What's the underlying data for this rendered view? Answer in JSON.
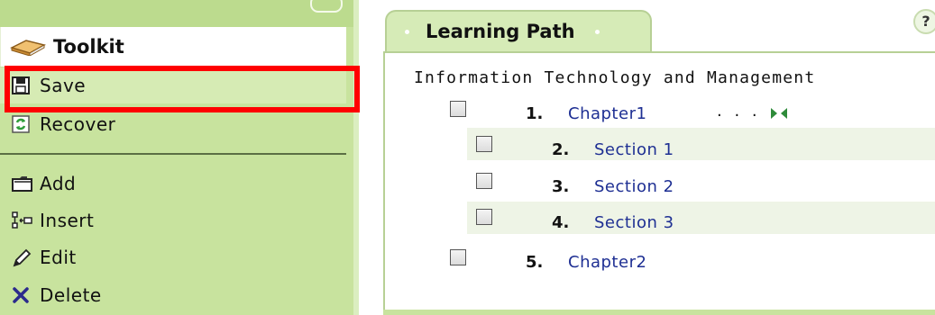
{
  "toolkit": {
    "title": "Toolkit",
    "items": [
      {
        "label": "Save",
        "icon": "floppy-disk-icon"
      },
      {
        "label": "Recover",
        "icon": "recover-icon"
      },
      {
        "label": "Add",
        "icon": "folder-icon"
      },
      {
        "label": "Insert",
        "icon": "insert-icon"
      },
      {
        "label": "Edit",
        "icon": "pencil-icon"
      },
      {
        "label": "Delete",
        "icon": "delete-x-icon"
      }
    ]
  },
  "learning_path": {
    "tab_label": "Learning Path",
    "help_label": "?",
    "course_title": "Information Technology and Management",
    "nodes": [
      {
        "number": "1.",
        "label": "Chapter1",
        "extra": ". . ."
      },
      {
        "number": "2.",
        "label": "Section 1"
      },
      {
        "number": "3.",
        "label": "Section 2"
      },
      {
        "number": "4.",
        "label": "Section 3"
      },
      {
        "number": "5.",
        "label": "Chapter2"
      }
    ]
  },
  "colors": {
    "panel_green": "#c8e39e",
    "highlight_red": "#ff0000",
    "link_blue": "#1e2f93"
  }
}
